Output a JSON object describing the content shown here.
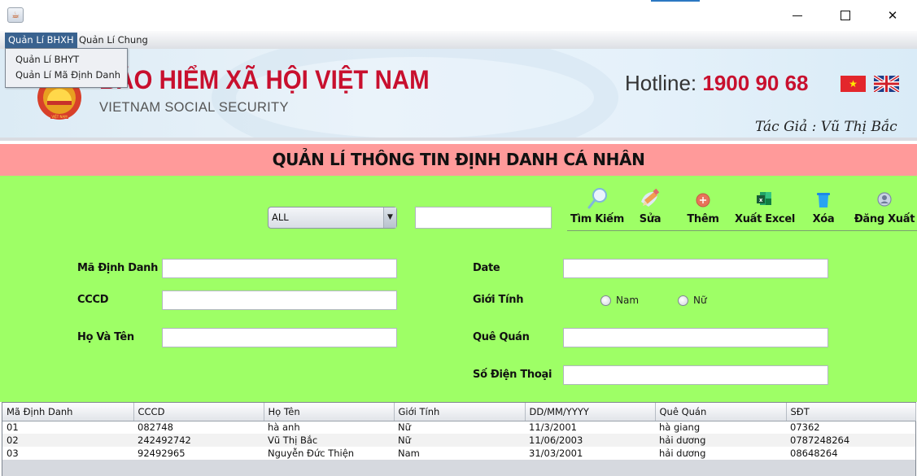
{
  "window": {
    "controls": {
      "minimize": "minimize",
      "maximize": "maximize",
      "close": "close"
    }
  },
  "menubar": {
    "items": [
      {
        "label": "Quản Lí BHXH",
        "active": true
      },
      {
        "label": "Quản Lí Chung",
        "active": false
      }
    ],
    "dropdown": [
      "Quản Lí BHYT",
      "Quản Lí Mã Định Danh"
    ]
  },
  "banner": {
    "title": "BẢO HIỂM XÃ HỘI VIỆT NAM",
    "subtitle": "VIETNAM SOCIAL SECURITY",
    "hotline_label": "Hotline: ",
    "hotline_number": "1900 90 68",
    "author": "Tác Giả : Vũ Thị Bắc",
    "colors": {
      "brand_red": "#c8102e"
    }
  },
  "header": {
    "title": "QUẢN LÍ THÔNG TIN ĐỊNH DANH CÁ NHÂN",
    "background": "#ff9a9a"
  },
  "search": {
    "filter_selected": "ALL",
    "query_value": ""
  },
  "toolbar": {
    "search": "Tìm Kiếm",
    "edit": "Sửa",
    "add": "Thêm",
    "export_excel": "Xuất Excel",
    "delete": "Xóa",
    "logout": "Đăng Xuất"
  },
  "form": {
    "ma_dinh_danh": {
      "label": "Mã Định Danh",
      "value": ""
    },
    "cccd": {
      "label": "CCCD",
      "value": ""
    },
    "ho_va_ten": {
      "label": "Họ Và Tên",
      "value": ""
    },
    "date": {
      "label": "Date",
      "value": ""
    },
    "gioi_tinh": {
      "label": "Giới Tính",
      "options": [
        "Nam",
        "Nữ"
      ],
      "selected": null
    },
    "que_quan": {
      "label": "Quê Quán",
      "value": ""
    },
    "so_dien_thoai": {
      "label": "Số Điện Thoại",
      "value": ""
    },
    "panel_color": "#9eff66"
  },
  "table": {
    "columns": [
      "Mã Định Danh",
      "CCCD",
      "Họ Tên",
      "Giới Tính",
      "DD/MM/YYYY",
      "Quê Quán",
      "SĐT"
    ],
    "rows": [
      [
        "01",
        "082748",
        "hà anh",
        "Nữ",
        "11/3/2001",
        "hà giang",
        "07362"
      ],
      [
        "02",
        "242492742",
        "Vũ Thị Bắc",
        "Nữ",
        "11/06/2003",
        "hải dương",
        "0787248264"
      ],
      [
        "03",
        "92492965",
        "Nguyễn Đức Thiện",
        "Nam",
        "31/03/2001",
        "hải dương",
        "08648264"
      ]
    ]
  }
}
